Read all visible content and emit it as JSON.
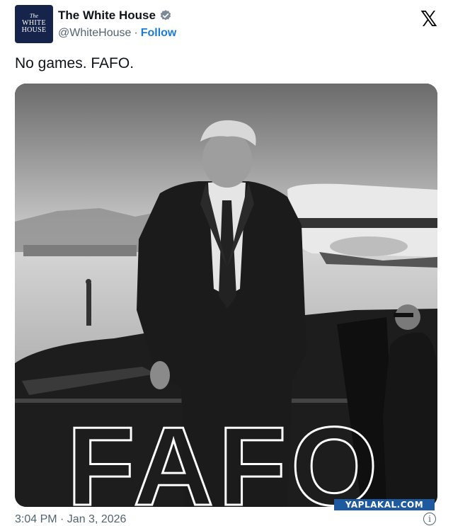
{
  "account": {
    "name": "The White House",
    "handle": "@WhiteHouse",
    "separator": "·",
    "follow_label": "Follow",
    "avatar_text": [
      "The",
      "WHITE",
      "HOUSE"
    ]
  },
  "tweet": {
    "text": "No games. FAFO.",
    "image_caption": "FAFO",
    "timestamp": "3:04 PM · Jan 3, 2026"
  },
  "icons": {
    "verified": "verified-badge-icon",
    "x_logo": "x-logo-icon",
    "info": "info-icon"
  },
  "watermark": "YAPLAKAL.COM",
  "colors": {
    "link": "#1d7bd8",
    "muted": "#536471",
    "text": "#0f1419"
  }
}
